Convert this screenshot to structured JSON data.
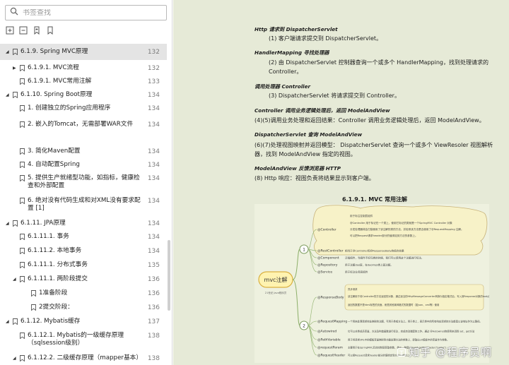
{
  "search": {
    "placeholder": "书签查找"
  },
  "toolbar": {
    "icons": [
      "expand-all-icon",
      "collapse-all-icon",
      "add-bookmark-icon",
      "bookmark-icon"
    ]
  },
  "tree": [
    {
      "level": 0,
      "arrow": "down",
      "label": "6.1.9. Spring MVC原理",
      "page": "132",
      "selected": true
    },
    {
      "level": 1,
      "arrow": "right",
      "label": "6.1.9.1. MVC流程",
      "page": "132"
    },
    {
      "level": 1,
      "arrow": "none",
      "label": "6.1.9.1. MVC常用注解",
      "page": "133"
    },
    {
      "level": 0,
      "arrow": "down",
      "label": "6.1.10. Spring Boot原理",
      "page": "134"
    },
    {
      "level": 1,
      "arrow": "none",
      "label": "1. 创建独立的Spring应用程序",
      "page": "134"
    },
    {
      "level": 1,
      "arrow": "none",
      "label": "2. 嵌入的Tomcat，无需部署WAR文件",
      "page": "134"
    },
    {
      "level": 1,
      "arrow": "none",
      "label": "3. 简化Maven配置",
      "page": "134"
    },
    {
      "level": 1,
      "arrow": "none",
      "label": "4. 自动配置Spring",
      "page": "134"
    },
    {
      "level": 1,
      "arrow": "none",
      "label": "5. 提供生产就绪型功能，如指标，健康检查和外部配置",
      "page": "134"
    },
    {
      "level": 1,
      "arrow": "none",
      "label": "6. 绝对没有代码生成和对XML没有要求配置 [1]",
      "page": "134"
    },
    {
      "level": 0,
      "arrow": "down",
      "label": "6.1.11. JPA原理",
      "page": "134"
    },
    {
      "level": 1,
      "arrow": "none",
      "label": "6.1.11.1. 事务",
      "page": "134"
    },
    {
      "level": 1,
      "arrow": "none",
      "label": "6.1.11.2. 本地事务",
      "page": "134"
    },
    {
      "level": 1,
      "arrow": "none",
      "label": "6.1.11.1. 分布式事务",
      "page": "135"
    },
    {
      "level": 1,
      "arrow": "down",
      "label": "6.1.11.1. 两阶段提交",
      "page": "136"
    },
    {
      "level": 2,
      "arrow": "none",
      "label": "1准备阶段",
      "page": "136"
    },
    {
      "level": 2,
      "arrow": "none",
      "label": "2提交阶段：",
      "page": "136"
    },
    {
      "level": 0,
      "arrow": "down",
      "label": "6.1.12. Mybatis缓存",
      "page": "137"
    },
    {
      "level": 1,
      "arrow": "none",
      "label": "6.1.12.1. Mybatis的一级缓存原理（sqlsession级别）",
      "page": "138"
    },
    {
      "level": 1,
      "arrow": "down",
      "label": "6.1.12.2. 二级缓存原理（mapper基本）",
      "page": "138"
    }
  ],
  "doc": {
    "sections": [
      {
        "heading": "Http 请求到 DispatcherServlet",
        "body": "(1) 客户端请求提交到 DispatcherServlet。"
      },
      {
        "heading": "HandlerMapping 寻找处理器",
        "body": "(2) 由 DispatcherServlet 控制器查询一个或多个 HandlerMapping，找到处理请求的 Controller。"
      },
      {
        "heading": "调用处理器 Controller",
        "body": "(3) DispatcherServlet 将请求提交到 Controller。"
      },
      {
        "heading": "Controller 调用业务逻辑处理后，返回 ModelAndView",
        "body": "(4)(5)调用业务处理和返回结果：Controller 调用业务逻辑处理后，返回 ModelAndView。"
      },
      {
        "heading": "DispatcherServlet 查询 ModelAndView",
        "body": "(6)(7)处理视图映射并返回模型： DispatcherServlet 查询一个或多个 ViewResoler 视图解析器，找到 ModelAndView 指定的视图。"
      },
      {
        "heading": "ModelAndView 反馈浏览器 HTTP",
        "body": "(8) Http 响应：视图负责将结果显示到客户端。"
      }
    ],
    "caption": "6.1.9.1.    MVC 常用注解"
  },
  "mindmap": {
    "root": "mvc注解",
    "root_note": "21世纪 Java程序员",
    "node1": "1",
    "node2": "2",
    "branch1": [
      {
        "tag": "@Controller",
        "notes": [
          "用于标注控制层组件",
          "@Controller 用于标记在一个类上，使用它标记的类就是一个SpringMVC Controller 对象",
          "分发处理器将会扫描使用了该注解的类的方法，并检测该方法是否使用了@RequestMapping 注解。",
          "可以把Request请求header部分的值绑定到方法的参数上。"
        ]
      },
      {
        "tag": "@RestController",
        "notes": [
          "相当于@Controller和@ResponseBody的组合效果"
        ]
      },
      {
        "tag": "@Component",
        "notes": [
          "泛指组件，当组件不好归类的时候，我们可以使用这个注解进行标注。"
        ]
      },
      {
        "tag": "@Repository",
        "notes": [
          "用于注解dao层，在daoImpl类上面注解。"
        ]
      },
      {
        "tag": "@Service",
        "notes": [
          "用于标注业务层组件"
        ]
      }
    ],
    "branch2": [
      {
        "tag": "@ResponseBody",
        "notes": [
          "异步请求",
          "该注解用于将Controller的方法返回的对象，通过适当的HttpMessageConverter转换为指定格式后，写入到Response对象的body数据区。",
          "返回的数据不是html标签的页面，而是其他某种格式的数据时（如json、xml等）使用"
        ]
      },
      {
        "tag": "@RequestMapping",
        "notes": [
          "一个用来处理请求地址映射的注解，可用于类或方法上。用于类上，表示类中的所有响应请求的方法都是以该地址作为父路径。"
        ]
      },
      {
        "tag": "@Autowired",
        "notes": [
          "它可以对类成员变量、方法及构造函数进行标注，完成自动装配的工作。通过 @Autowired的使用来消除 set，get方法"
        ]
      },
      {
        "tag": "@PathVariable",
        "notes": [
          "用于将请求URL中的模板变量映射到功能处理方法的参数上，即取出uri模板中的变量作为参数。"
        ]
      },
      {
        "tag": "@requestParam",
        "notes": [
          "主要用于在SpringMVC后台控制层获取参数，类似一种是request.getParameter(\"name\")"
        ]
      },
      {
        "tag": "@RequestHeader",
        "notes": [
          "可以把Request请求header部分的值绑定到方法的参数上。"
        ]
      }
    ]
  },
  "watermark": "知乎 @程序员啊"
}
